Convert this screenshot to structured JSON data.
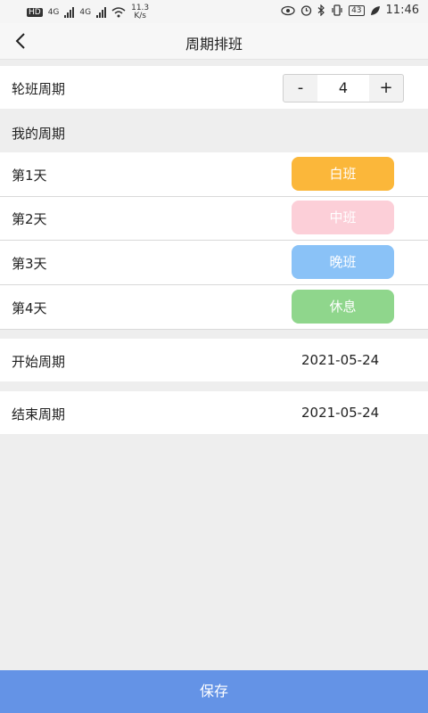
{
  "status_bar": {
    "hd_label": "HD",
    "net1": "4G",
    "net2": "4G",
    "speed_value": "11.3",
    "speed_unit": "K/s",
    "battery": "43",
    "time": "11:46"
  },
  "header": {
    "title": "周期排班"
  },
  "cycle": {
    "label": "轮班周期",
    "minus": "-",
    "value": "4",
    "plus": "+"
  },
  "my_cycle": {
    "title": "我的周期",
    "days": [
      {
        "label": "第1天",
        "shift": "白班",
        "color": "#fbb73a"
      },
      {
        "label": "第2天",
        "shift": "中班",
        "color": "#fccfd8"
      },
      {
        "label": "第3天",
        "shift": "晚班",
        "color": "#8ac2f7"
      },
      {
        "label": "第4天",
        "shift": "休息",
        "color": "#8fd68c"
      }
    ]
  },
  "start": {
    "label": "开始周期",
    "date": "2021-05-24"
  },
  "end": {
    "label": "结束周期",
    "date": "2021-05-24"
  },
  "footer": {
    "save_label": "保存"
  }
}
